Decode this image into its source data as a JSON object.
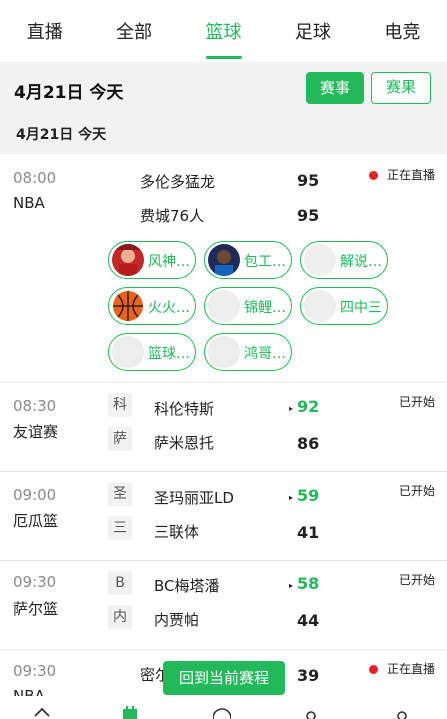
{
  "nav": {
    "tabs": [
      {
        "label": "直播"
      },
      {
        "label": "全部"
      },
      {
        "label": "篮球"
      },
      {
        "label": "足球"
      },
      {
        "label": "电竞"
      }
    ],
    "active_index": 2
  },
  "date_header": {
    "title": "4月21日 今天",
    "subtitle": "4月21日  今天",
    "btn_events": "赛事",
    "btn_results": "赛果"
  },
  "matches": [
    {
      "time": "08:00",
      "league": "NBA",
      "home": "多伦多猛龙",
      "away": "费城76人",
      "home_score": "95",
      "away_score": "95",
      "status": "正在直播",
      "streamers": [
        "风神…",
        "包工…",
        "解说…",
        "火火…",
        "锦鲤…",
        "四中三",
        "篮球…",
        "鸿哥…"
      ]
    },
    {
      "time": "08:30",
      "league": "友谊赛",
      "home_tag": "科",
      "away_tag": "萨",
      "home": "科伦特斯",
      "away": "萨米恩托",
      "home_score": "92",
      "away_score": "86",
      "status": "已开始"
    },
    {
      "time": "09:00",
      "league": "厄瓜篮",
      "home_tag": "圣",
      "away_tag": "三",
      "home": "圣玛丽亚LD",
      "away": "三联体",
      "home_score": "59",
      "away_score": "41",
      "status": "已开始"
    },
    {
      "time": "09:30",
      "league": "萨尔篮",
      "home_tag": "B",
      "away_tag": "内",
      "home": "BC梅塔潘",
      "away": "内贾帕",
      "home_score": "58",
      "away_score": "44",
      "status": "已开始"
    },
    {
      "time": "09:30",
      "league": "NBA",
      "home": "密尔",
      "home_score": "39",
      "status": "正在直播"
    }
  ],
  "float_button": "回到当前赛程",
  "colors": {
    "accent": "#22b95a",
    "live_dot": "#e8202a",
    "header_bg": "#f2f2f2"
  }
}
